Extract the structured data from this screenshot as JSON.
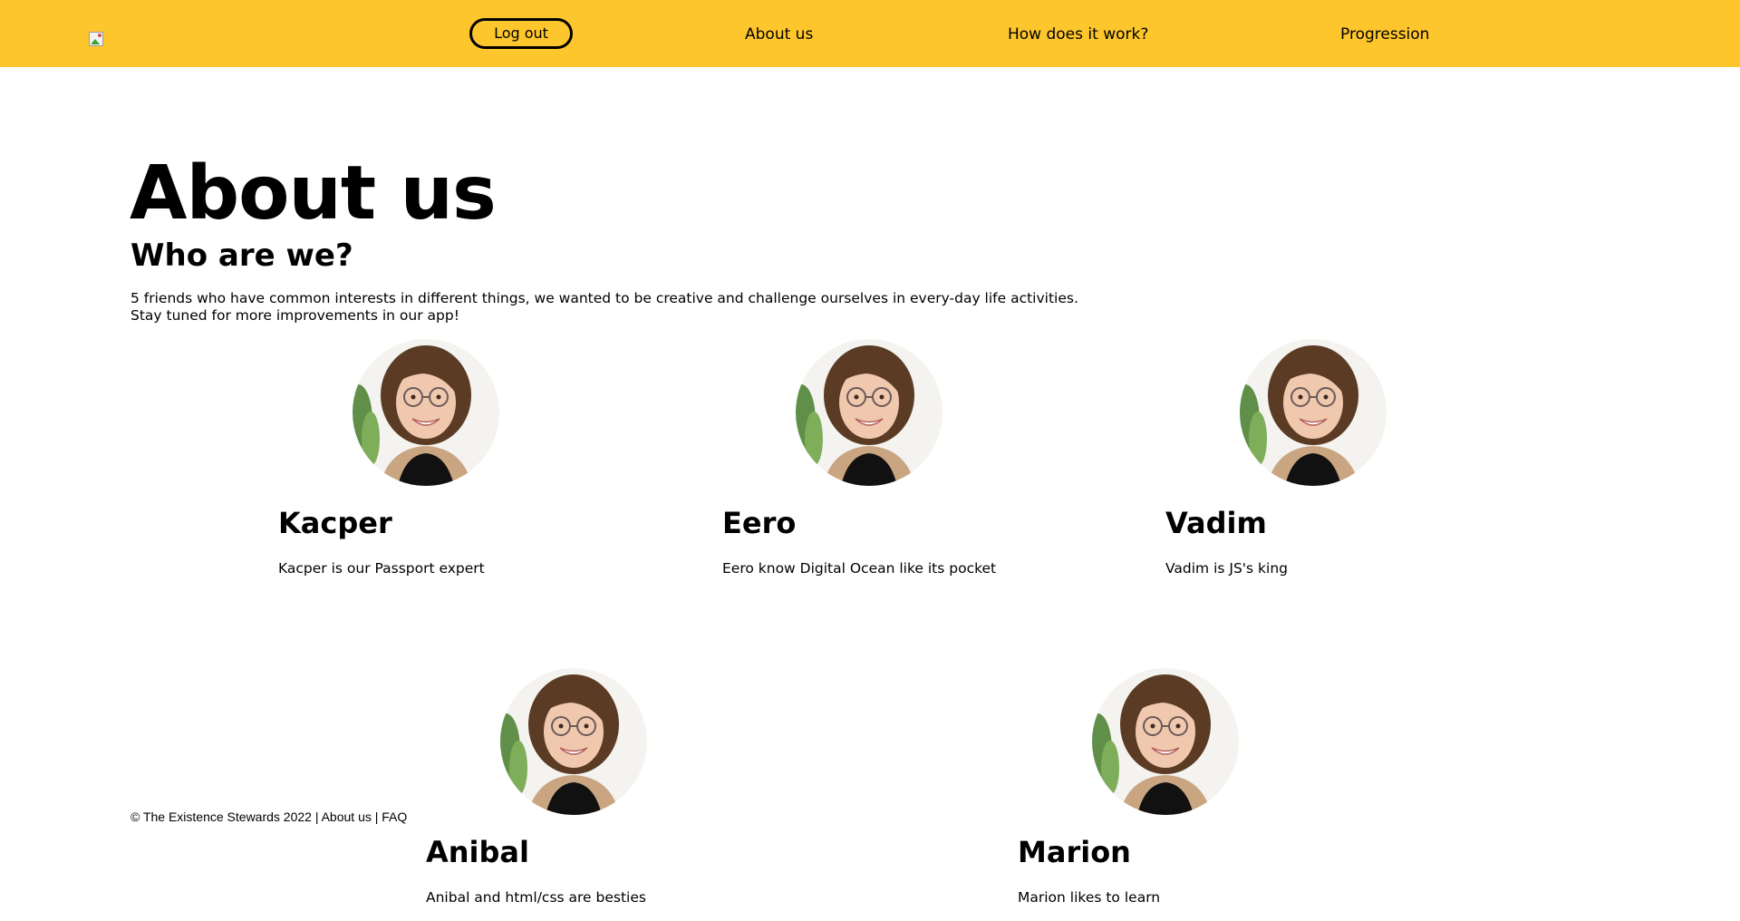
{
  "nav": {
    "logout_label": "Log out",
    "links": [
      "About us",
      "How does it work?",
      "Progression"
    ],
    "background": "#fec62d"
  },
  "page": {
    "title": "About us",
    "subtitle": "Who are we?",
    "intro_line1": "5 friends who have common interests in different things, we wanted to be creative and challenge ourselves in every-day life activities.",
    "intro_line2": "Stay tuned for more improvements in our app!"
  },
  "members": [
    {
      "name": "Kacper",
      "description": "Kacper is our Passport expert"
    },
    {
      "name": "Eero",
      "description": "Eero know Digital Ocean like its pocket"
    },
    {
      "name": "Vadim",
      "description": "Vadim is JS's king"
    },
    {
      "name": "Anibal",
      "description": "Anibal and html/css are besties"
    },
    {
      "name": "Marion",
      "description": "Marion likes to learn"
    }
  ],
  "footer": {
    "copyright": "© The Existence Stewards 2022 | ",
    "about_link": "About us",
    "separator": " | ",
    "faq_link": "FAQ"
  }
}
